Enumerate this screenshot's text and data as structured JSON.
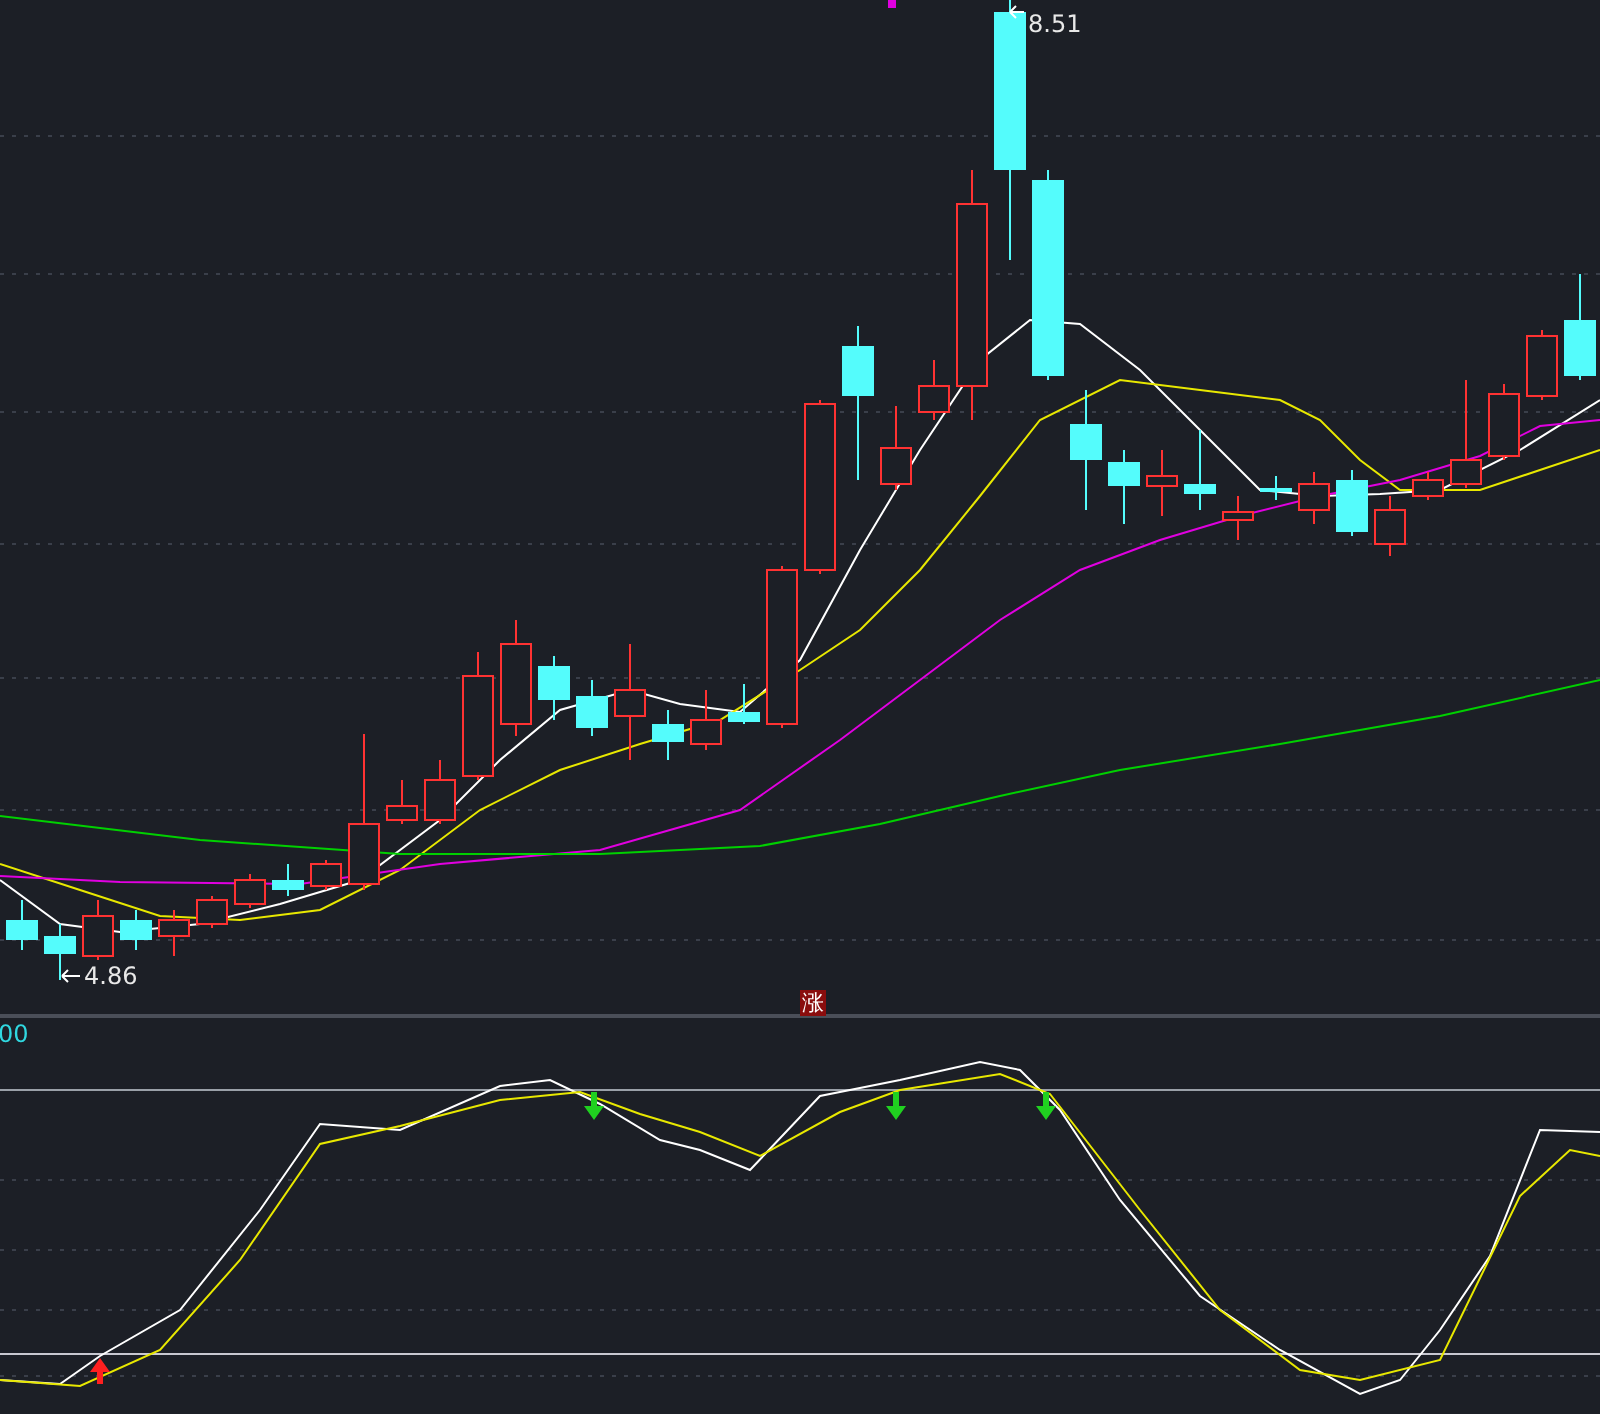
{
  "price_panel": {
    "high_label": "8.51",
    "low_label": "4.86",
    "badge": "涨"
  },
  "indicator_panel": {
    "value_label": "00"
  }
}
